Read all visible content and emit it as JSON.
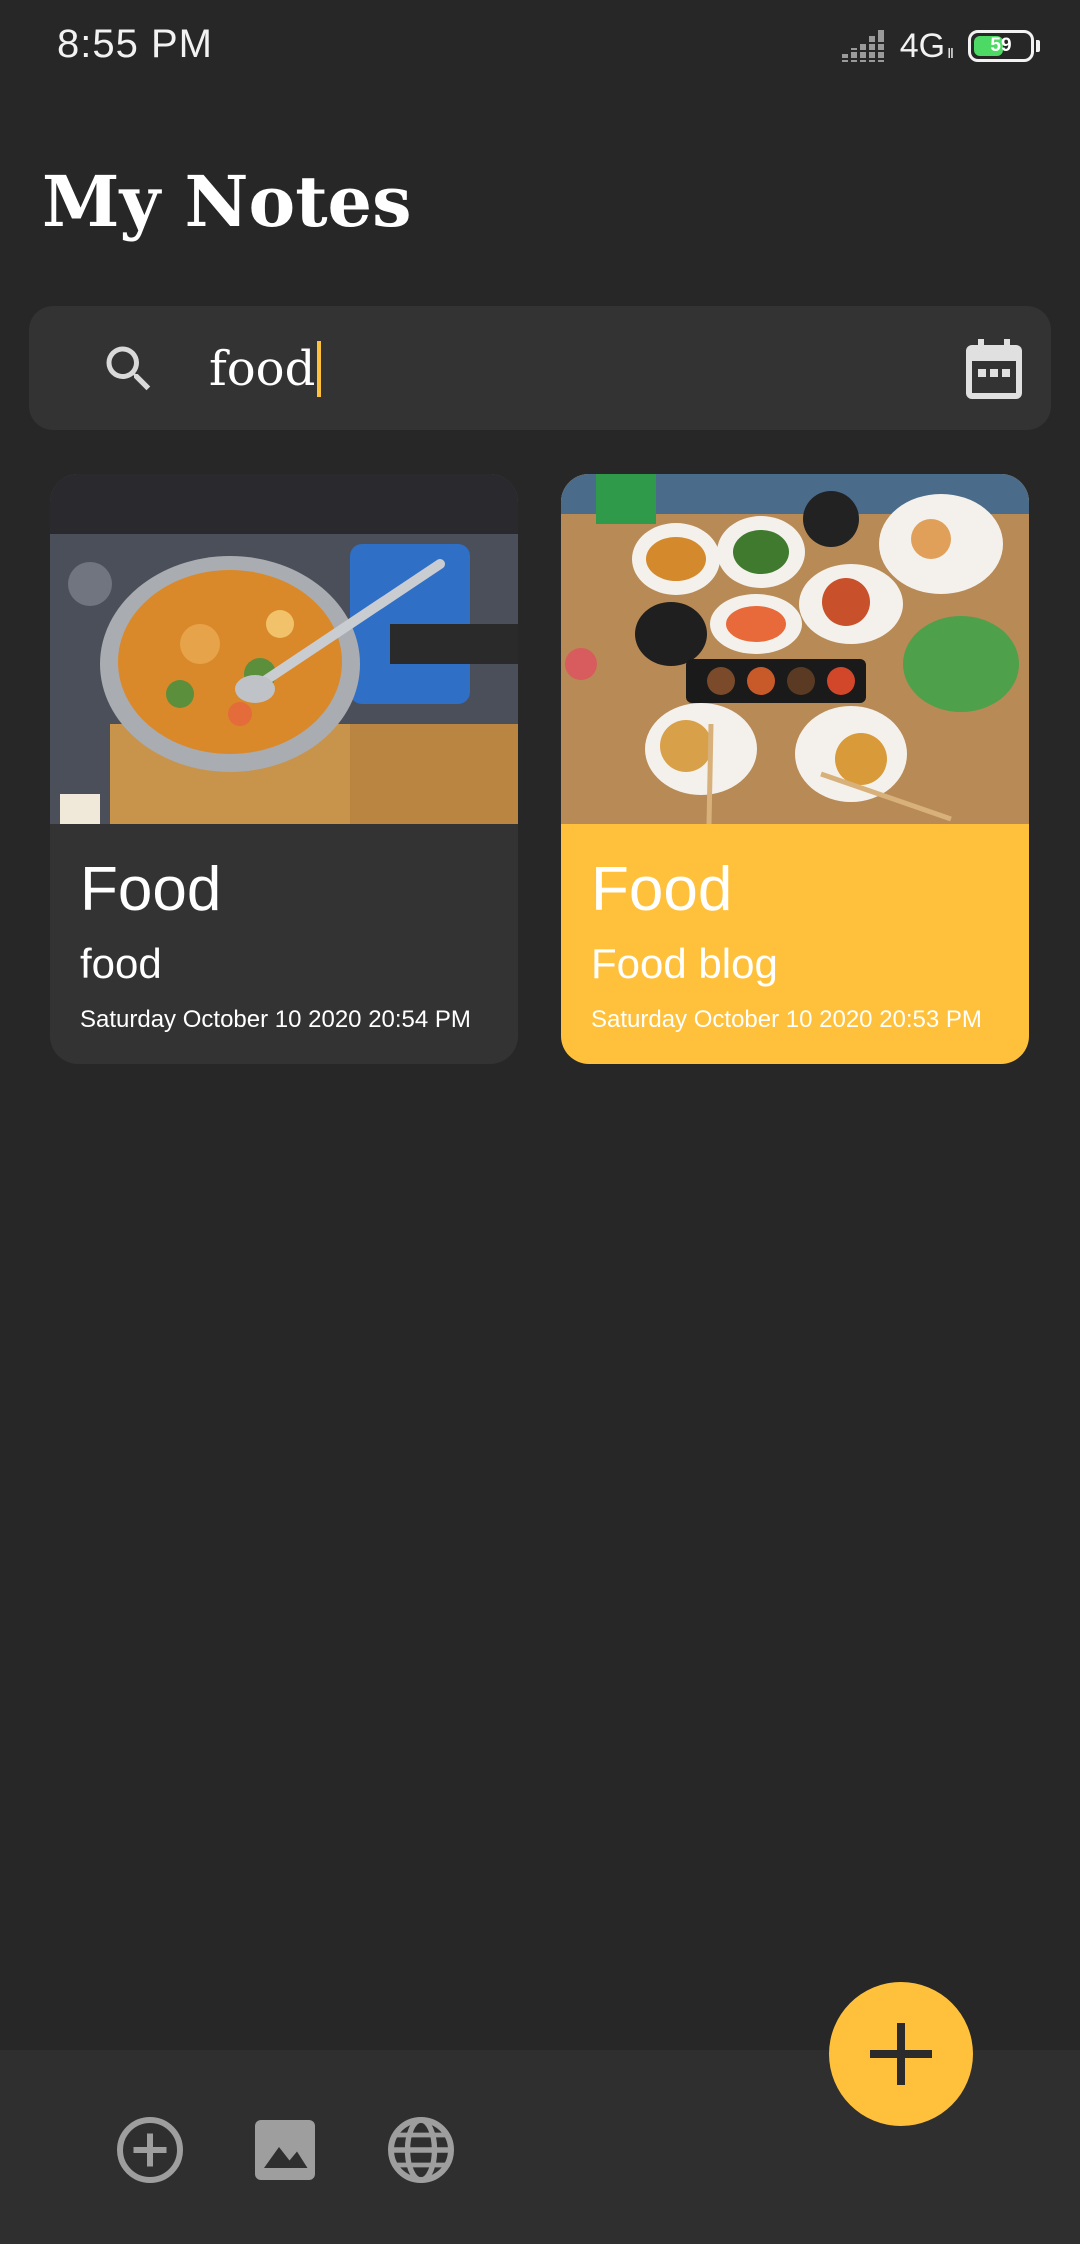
{
  "status_bar": {
    "time": "8:55 PM",
    "network": "4G",
    "network_sub": "Ⅱ",
    "battery_level": 59,
    "battery_label": "59"
  },
  "page": {
    "title": "My Notes"
  },
  "search": {
    "value": "food",
    "icon": "search-icon",
    "action_icon": "calendar-icon"
  },
  "notes": [
    {
      "title": "Food",
      "subtitle": "food",
      "datetime": "Saturday October 10 2020 20:54 PM",
      "image": "hot-pot-photo",
      "color": "#333333"
    },
    {
      "title": "Food",
      "subtitle": "Food blog",
      "datetime": "Saturday October 10 2020 20:53 PM",
      "image": "seafood-table-photo",
      "color": "#ffc13b"
    }
  ],
  "bottom_bar": {
    "icons": [
      "add-circle-icon",
      "image-icon",
      "globe-icon"
    ]
  },
  "fab": {
    "icon": "plus-icon"
  },
  "colors": {
    "background": "#272727",
    "accent": "#ffc13b",
    "surface": "#333333"
  }
}
